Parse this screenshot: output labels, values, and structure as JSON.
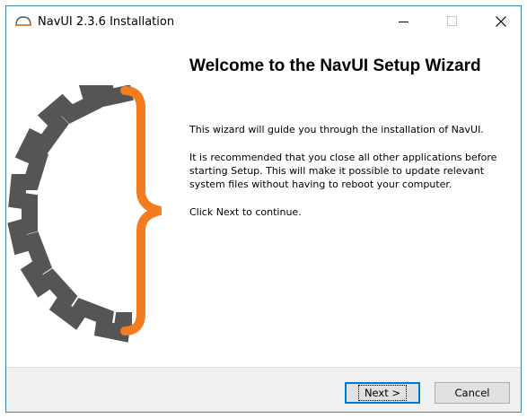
{
  "window": {
    "title": "NavUI 2.3.6 Installation",
    "icon": "navui-app-icon"
  },
  "titlebar_buttons": {
    "minimize": "minimize-icon",
    "maximize": "maximize-icon",
    "close": "close-icon"
  },
  "content": {
    "heading": "Welcome to the NavUI Setup Wizard",
    "paragraph_1": "This wizard will guide you through the installation of NavUI.",
    "paragraph_2": "It is recommended that you close all other applications before starting Setup. This will make it possible to update relevant system files without having to reboot your computer.",
    "paragraph_3": "Click Next to continue.",
    "side_graphic": "gear-brace-graphic"
  },
  "footer": {
    "next_label": "Next >",
    "cancel_label": "Cancel"
  },
  "colors": {
    "gear_gray": "#555555",
    "brace_orange": "#f47b20",
    "accent_blue": "#0078d7"
  }
}
